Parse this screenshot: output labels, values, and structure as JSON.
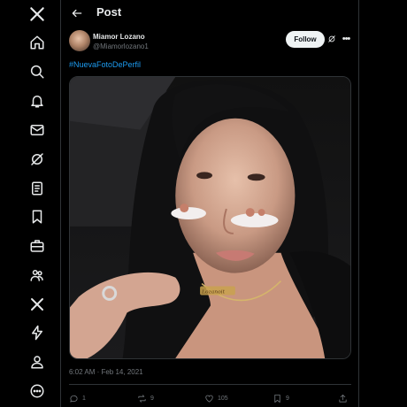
{
  "sidebar": {
    "items": [
      {
        "name": "x-logo-icon"
      },
      {
        "name": "home-icon"
      },
      {
        "name": "search-icon"
      },
      {
        "name": "notifications-icon"
      },
      {
        "name": "messages-icon"
      },
      {
        "name": "grok-icon"
      },
      {
        "name": "lists-icon"
      },
      {
        "name": "bookmarks-icon"
      },
      {
        "name": "jobs-icon"
      },
      {
        "name": "communities-icon"
      },
      {
        "name": "premium-icon"
      },
      {
        "name": "verified-orgs-icon"
      },
      {
        "name": "profile-icon"
      },
      {
        "name": "more-icon"
      }
    ]
  },
  "header": {
    "title": "Post"
  },
  "post": {
    "author_name": "Miamor Lozano",
    "author_handle": "@Miamorlozano1",
    "hashtag": "#NuevaFotoDePerfil",
    "follow_label": "Follow",
    "timestamp": "6:02 AM · Feb 14, 2021",
    "necklace_text": "Lozanoit"
  },
  "actions": {
    "replies": "1",
    "reposts": "9",
    "likes": "105",
    "bookmarks": "9"
  },
  "colors": {
    "background": "#000000",
    "text": "#e7e9ea",
    "muted": "#71767b",
    "accent": "#1d9bf0",
    "border": "#2f3336",
    "follow_bg": "#eff3f4"
  }
}
